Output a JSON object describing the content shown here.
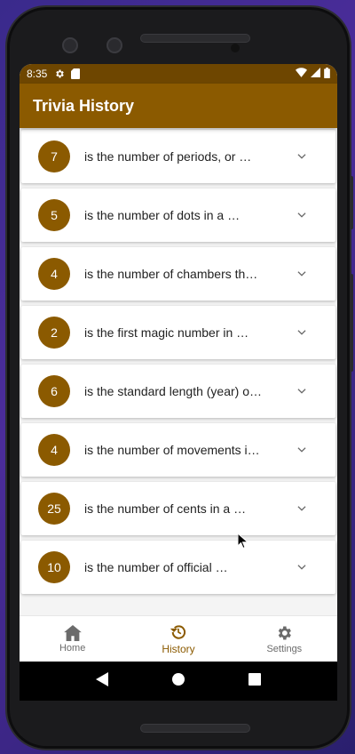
{
  "status_bar": {
    "time": "8:35",
    "icons": [
      "gear-icon",
      "sd-card-icon",
      "wifi-icon",
      "signal-icon",
      "battery-icon"
    ]
  },
  "app_bar": {
    "title": "Trivia History"
  },
  "history": [
    {
      "number": "7",
      "text": "is the number of periods, or …"
    },
    {
      "number": "5",
      "text": "is the number of dots in a …"
    },
    {
      "number": "4",
      "text": "is the number of chambers th…"
    },
    {
      "number": "2",
      "text": "is the first magic number in …"
    },
    {
      "number": "6",
      "text": "is the standard length (year) o…"
    },
    {
      "number": "4",
      "text": "is the number of movements i…"
    },
    {
      "number": "25",
      "text": "is the number of cents in a …"
    },
    {
      "number": "10",
      "text": "is the number of official …"
    }
  ],
  "bottom_nav": {
    "home": "Home",
    "history": "History",
    "settings": "Settings",
    "active": "history"
  },
  "colors": {
    "primary": "#8b5a00",
    "status_bar": "#6e4600",
    "background": "#f4f4f4"
  }
}
